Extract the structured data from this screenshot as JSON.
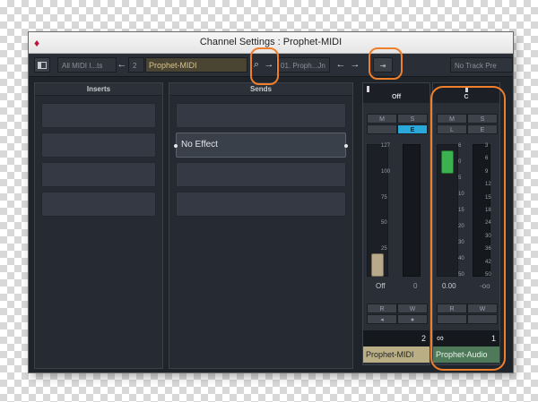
{
  "window": {
    "title": "Channel Settings : Prophet-MIDI"
  },
  "toolbar": {
    "channel_filter": "All MIDI I...ts",
    "channel_number": "2",
    "channel_name": "Prophet-MIDI",
    "next_channel_field": "01. Proph...Jn",
    "no_track_preset": "No Track Pre"
  },
  "inserts": {
    "header": "Inserts"
  },
  "sends": {
    "header": "Sends",
    "slot_1_label": "No Effect"
  },
  "midi_strip": {
    "pan": "Off",
    "mute": "M",
    "solo": "S",
    "edit": "E",
    "volume_readout": "Off",
    "meter_readout": "0",
    "read": "R",
    "write": "W",
    "number": "2",
    "name": "Prophet-MIDI",
    "scale": [
      "127",
      "100",
      "75",
      "50",
      "25",
      "0"
    ],
    "fader_value": 0
  },
  "audio_strip": {
    "pan": "C",
    "mute": "M",
    "solo": "S",
    "edit": "E",
    "volume_readout": "0.00",
    "meter_readout": "-oo",
    "read": "R",
    "write": "W",
    "link_icon": "link-icon",
    "number": "1",
    "name": "Prophet-Audio",
    "scale_left": [
      "6",
      "0",
      "5",
      "10",
      "15",
      "20",
      "30",
      "40",
      "50"
    ],
    "scale_right": [
      "3",
      "6",
      "9",
      "12",
      "15",
      "18",
      "24",
      "30",
      "36",
      "42",
      "50"
    ],
    "fader_db": 0
  },
  "colors": {
    "annotation": "#f07f2c",
    "edit_active": "#2aa8d9",
    "audio_fader": "#3bb14f"
  }
}
